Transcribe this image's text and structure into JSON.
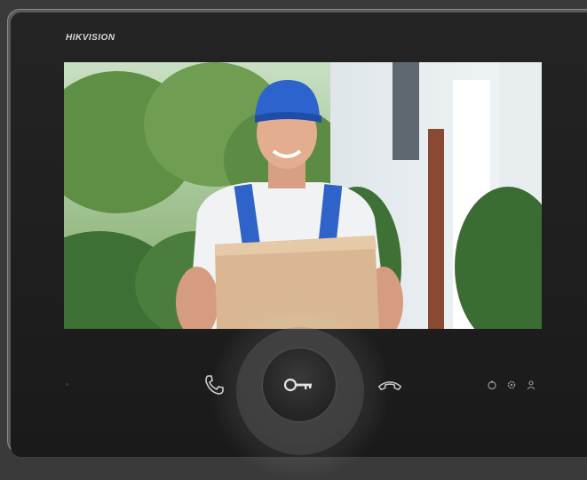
{
  "device": {
    "brand": "HIKVISION"
  },
  "screen": {
    "feed_description_icon": "camera-feed"
  },
  "controls": {
    "call_icon": "answer-call-icon",
    "unlock_icon": "key-unlock-icon",
    "hangup_icon": "hangup-icon",
    "status_icons": [
      "alarm-icon",
      "settings-icon",
      "user-icon"
    ]
  },
  "colors": {
    "bezel": "#1e1e1e",
    "icon": "#d0d0d0"
  }
}
